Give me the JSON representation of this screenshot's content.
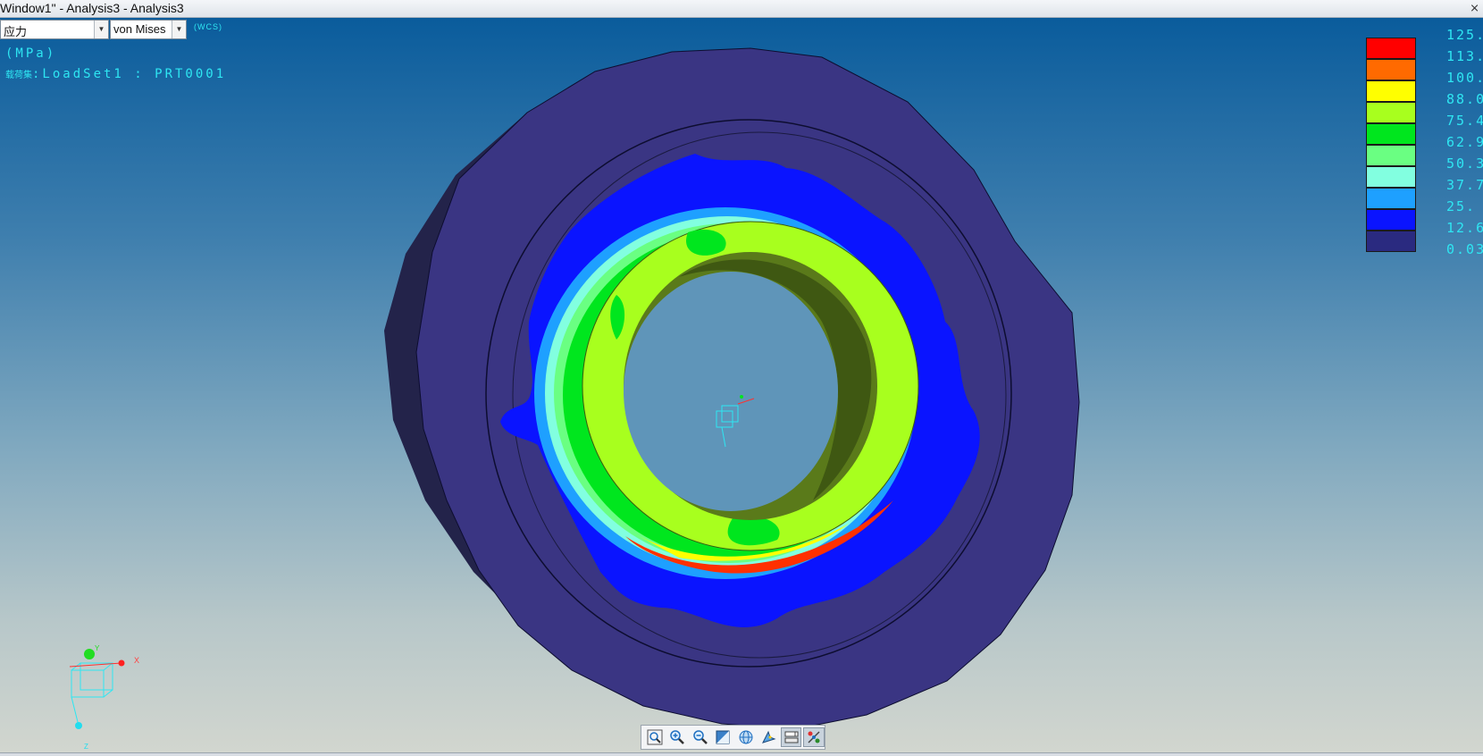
{
  "window": {
    "title": "Window1\" - Analysis3 - Analysis3",
    "close_glyph": "⨯"
  },
  "result_controls": {
    "quantity_value": "应力",
    "component_value": "von Mises",
    "coord_system": "(WCS)"
  },
  "info": {
    "units": "(MPa)",
    "loadset_prefix": "载荷集",
    "loadset": ":LoadSet1  :   PRT0001"
  },
  "legend": {
    "colors": [
      "#ff0000",
      "#ff6a00",
      "#ffff00",
      "#a8ff1e",
      "#00e61e",
      "#6aff82",
      "#82ffe0",
      "#1ea0ff",
      "#0a14ff",
      "#2a2a80"
    ],
    "labels": [
      "125.",
      "113.",
      "100.",
      "88.0",
      "75.4",
      "62.9",
      "50.3",
      "37.7",
      "25.",
      "12.6",
      "0.03"
    ]
  },
  "triad": {
    "x_label": "X",
    "y_label": "Y",
    "z_label": "Z"
  },
  "toolbar": {
    "buttons": [
      {
        "icon": "zoom-fit-icon"
      },
      {
        "icon": "zoom-in-icon"
      },
      {
        "icon": "zoom-out-icon"
      },
      {
        "icon": "repaint-icon"
      },
      {
        "icon": "shading-icon"
      },
      {
        "icon": "spin-center-icon"
      },
      {
        "icon": "view-manager-icon"
      },
      {
        "icon": "display-toggle-icon"
      }
    ]
  }
}
